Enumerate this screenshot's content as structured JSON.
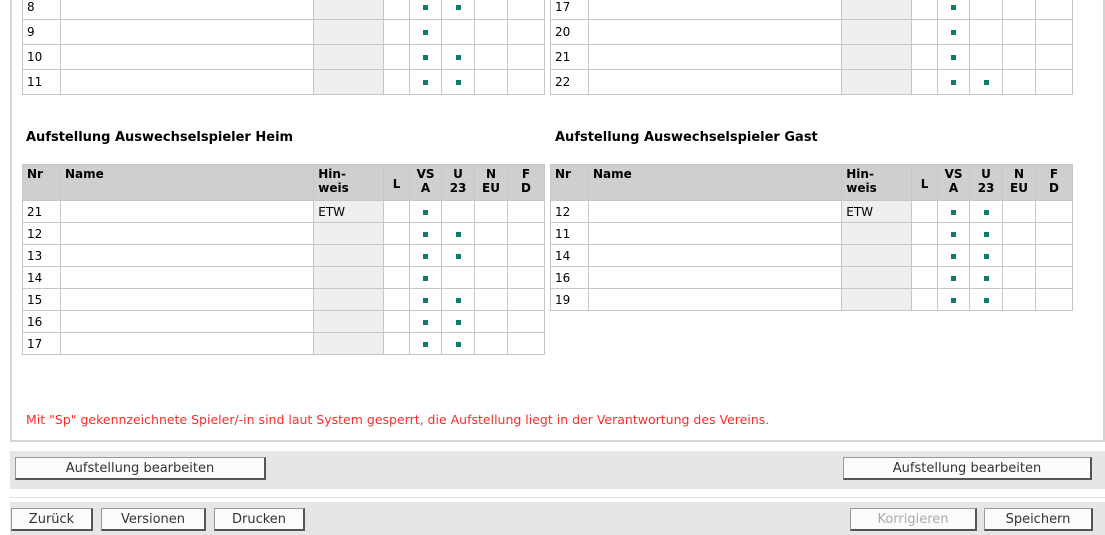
{
  "top_tables": {
    "heim_rows": [
      {
        "nr": "8",
        "hinweis": "",
        "vsa": true,
        "u23": true
      },
      {
        "nr": "9",
        "hinweis": "",
        "vsa": true,
        "u23": false
      },
      {
        "nr": "10",
        "hinweis": "",
        "vsa": true,
        "u23": true
      },
      {
        "nr": "11",
        "hinweis": "",
        "vsa": true,
        "u23": true
      }
    ],
    "gast_rows": [
      {
        "nr": "17",
        "hinweis": "",
        "vsa": true,
        "u23": false
      },
      {
        "nr": "20",
        "hinweis": "",
        "vsa": true,
        "u23": false
      },
      {
        "nr": "21",
        "hinweis": "",
        "vsa": true,
        "u23": false
      },
      {
        "nr": "22",
        "hinweis": "",
        "vsa": true,
        "u23": true
      }
    ]
  },
  "sections": {
    "heim_title": "Aufstellung Auswechselspieler Heim",
    "gast_title": "Aufstellung Auswechselspieler Gast"
  },
  "columns": {
    "nr": "Nr",
    "name": "Name",
    "hinweis_1": "Hin-",
    "hinweis_2": "weis",
    "l": "L",
    "vsa_1": "VS",
    "vsa_2": "A",
    "u23_1": "U",
    "u23_2": "23",
    "neu_1": "N",
    "neu_2": "EU",
    "fd_1": "F",
    "fd_2": "D"
  },
  "heim_subs": [
    {
      "nr": "21",
      "hinweis": "ETW",
      "vsa": true,
      "u23": false
    },
    {
      "nr": "12",
      "hinweis": "",
      "vsa": true,
      "u23": true
    },
    {
      "nr": "13",
      "hinweis": "",
      "vsa": true,
      "u23": true
    },
    {
      "nr": "14",
      "hinweis": "",
      "vsa": true,
      "u23": false
    },
    {
      "nr": "15",
      "hinweis": "",
      "vsa": true,
      "u23": true
    },
    {
      "nr": "16",
      "hinweis": "",
      "vsa": true,
      "u23": true
    },
    {
      "nr": "17",
      "hinweis": "",
      "vsa": true,
      "u23": true
    }
  ],
  "gast_subs": [
    {
      "nr": "12",
      "hinweis": "ETW",
      "vsa": true,
      "u23": true
    },
    {
      "nr": "11",
      "hinweis": "",
      "vsa": true,
      "u23": true
    },
    {
      "nr": "14",
      "hinweis": "",
      "vsa": true,
      "u23": true
    },
    {
      "nr": "16",
      "hinweis": "",
      "vsa": true,
      "u23": true
    },
    {
      "nr": "19",
      "hinweis": "",
      "vsa": true,
      "u23": true
    }
  ],
  "warning": "Mit \"Sp\" gekennzeichnete Spieler/-in sind laut System gesperrt, die Aufstellung liegt in der Verantwortung des Vereins.",
  "buttons": {
    "edit_heim": "Aufstellung bearbeiten",
    "edit_gast": "Aufstellung bearbeiten",
    "back": "Zurück",
    "versions": "Versionen",
    "print": "Drucken",
    "correct": "Korrigieren",
    "save": "Speichern"
  },
  "colors": {
    "marker": "#0f7a6e",
    "warning": "#ff2a2a",
    "header_bg": "#cfcfcf"
  }
}
